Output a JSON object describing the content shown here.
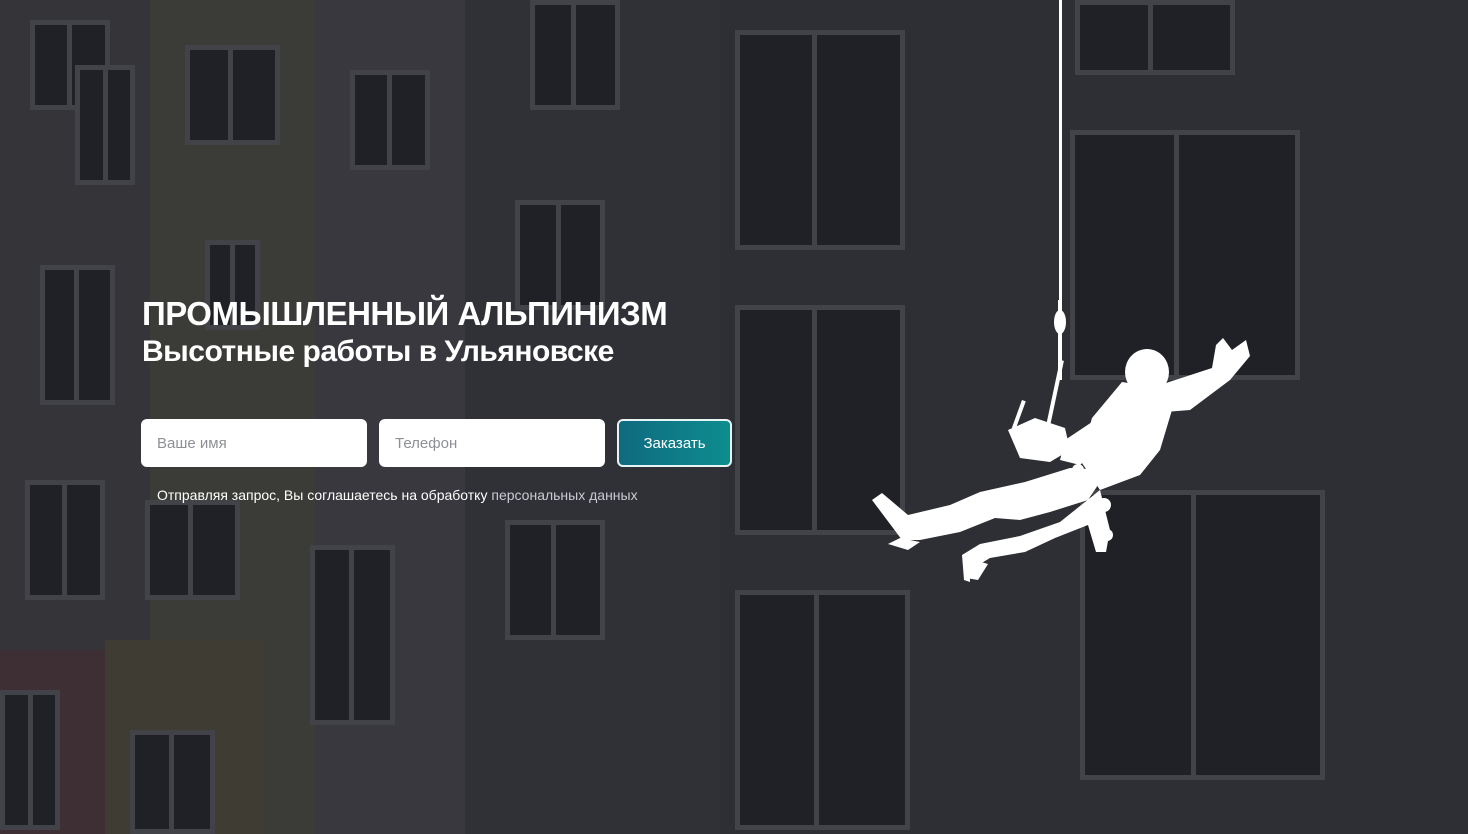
{
  "hero": {
    "title": "ПРОМЫШЛЕННЫЙ АЛЬПИНИЗМ",
    "subtitle": "Высотные работы в Ульяновске"
  },
  "form": {
    "name_placeholder": "Ваше имя",
    "phone_placeholder": "Телефон",
    "submit_label": "Заказать",
    "consent_text": "Отправляя запрос, Вы соглашаетесь на обработку",
    "consent_link_label": "персональных данных"
  },
  "colors": {
    "button_gradient_start": "#0f6a80",
    "button_gradient_end": "#0d8d8e",
    "text": "#ffffff"
  },
  "icons": {
    "climber": "industrial-climber-silhouette-icon"
  }
}
